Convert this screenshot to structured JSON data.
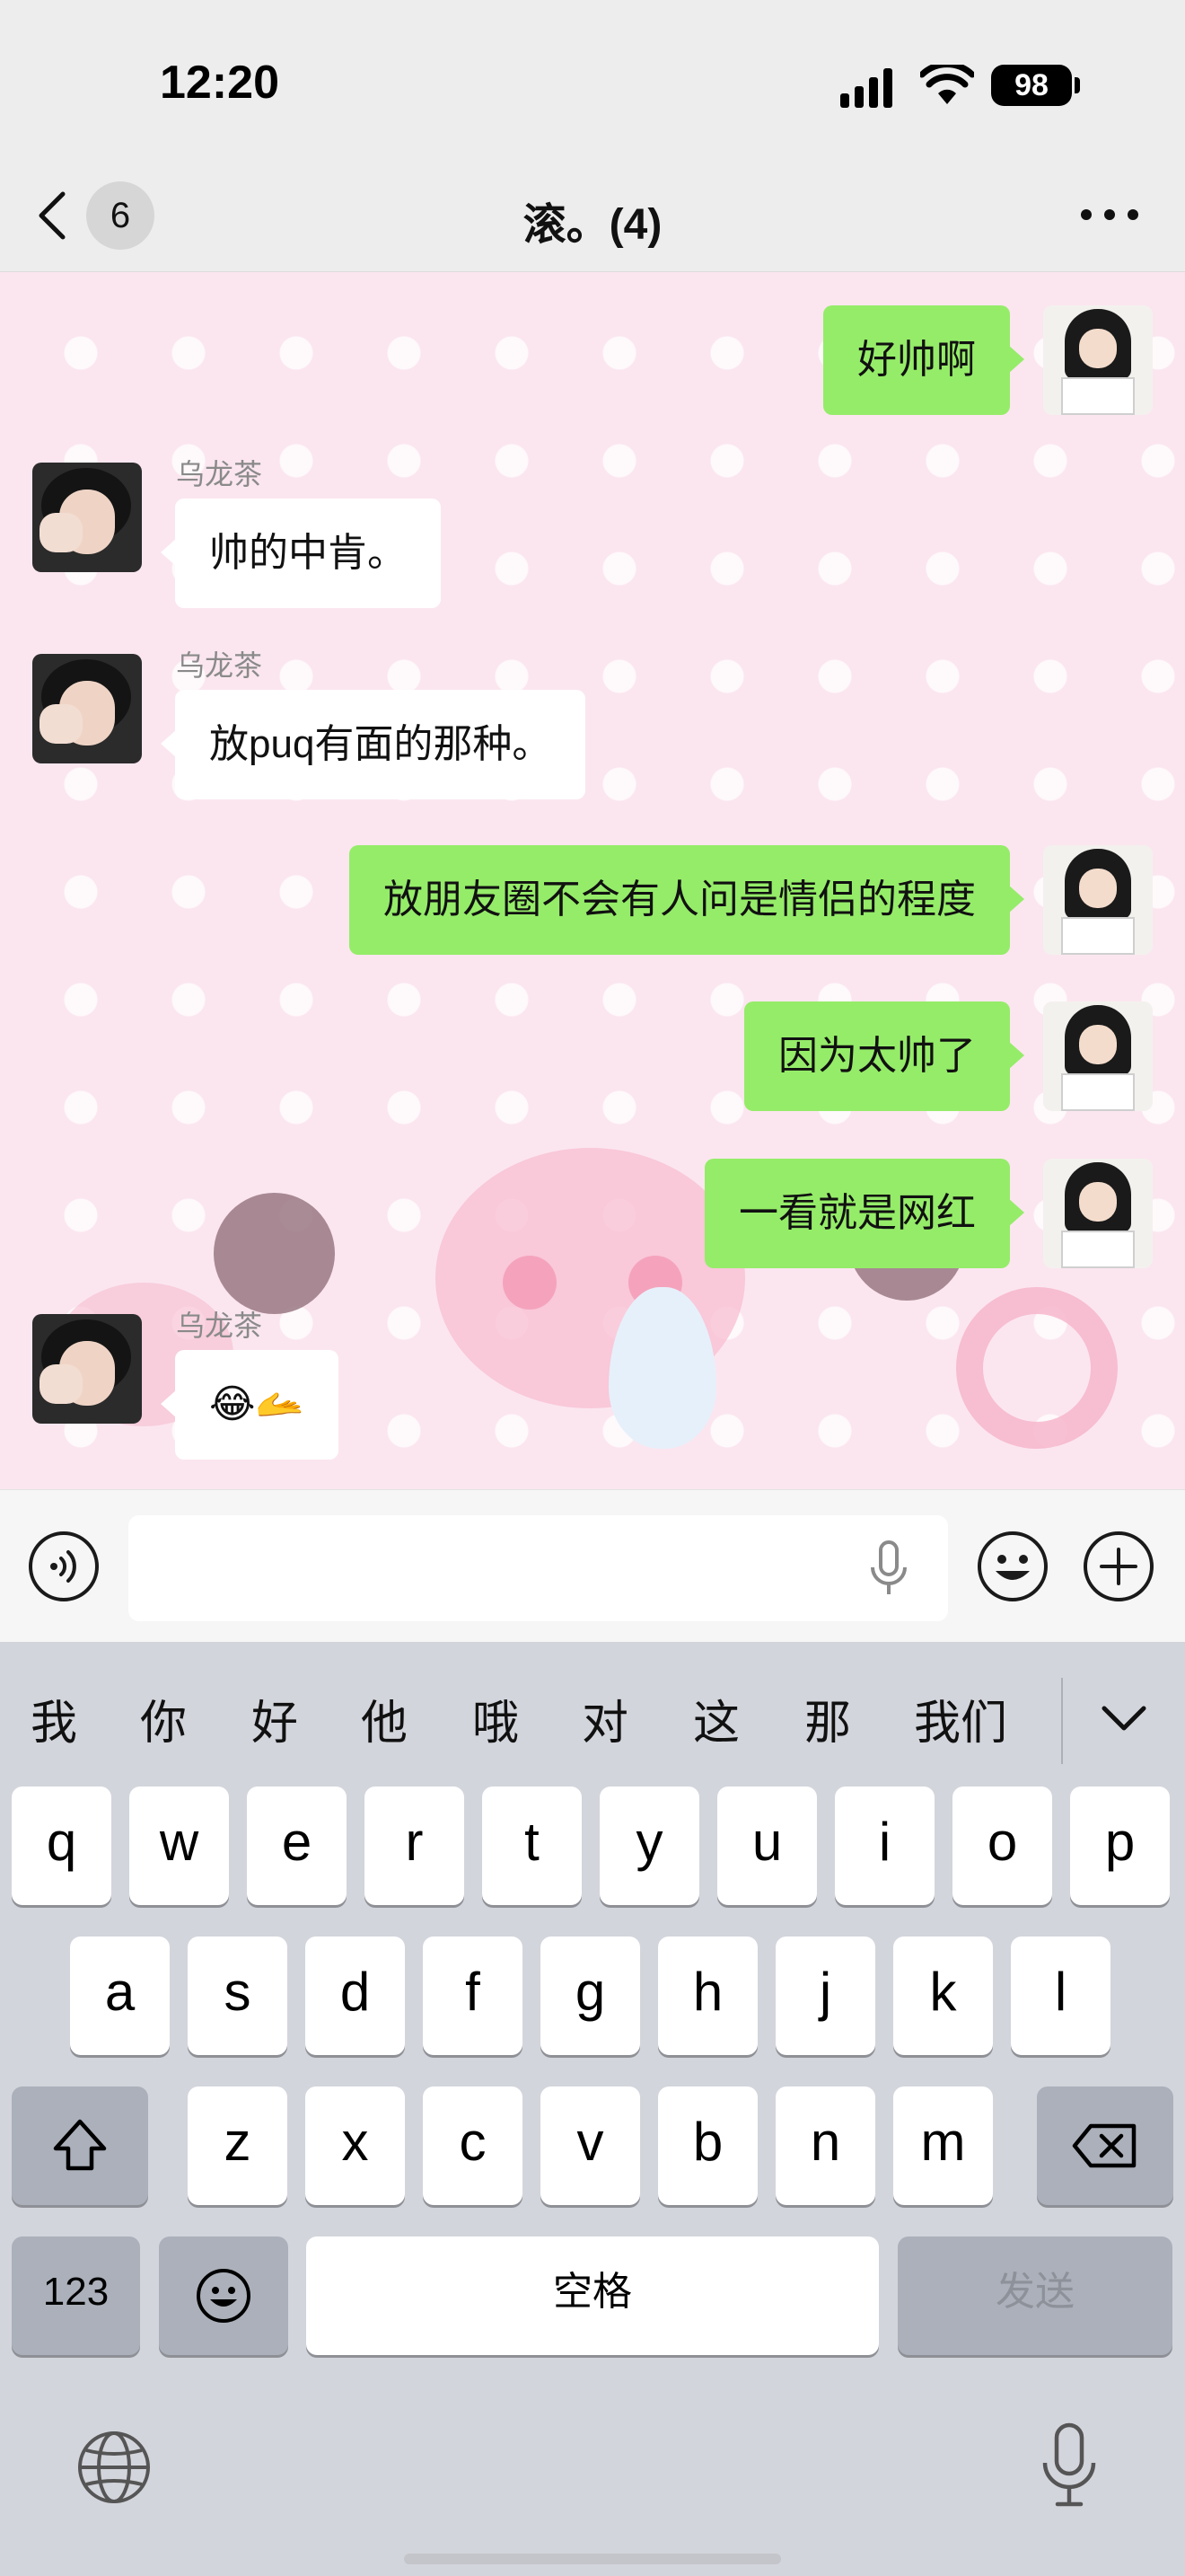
{
  "status_bar": {
    "time": "12:20",
    "battery": "98"
  },
  "nav": {
    "back_badge": "6",
    "title": "滚。(4)",
    "more_icon": "more-icon"
  },
  "messages": [
    {
      "side": "self",
      "text": "好帅啊"
    },
    {
      "side": "other",
      "sender": "乌龙茶",
      "text": "帅的中肯。"
    },
    {
      "side": "other",
      "sender": "乌龙茶",
      "text": "放puq有面的那种。"
    },
    {
      "side": "self",
      "text": "放朋友圈不会有人问是情侣的程度"
    },
    {
      "side": "self",
      "text": "因为太帅了"
    },
    {
      "side": "self",
      "text": "一看就是网红"
    },
    {
      "side": "other",
      "sender": "乌龙茶",
      "text": "😂🫴"
    }
  ],
  "input_bar": {
    "placeholder": ""
  },
  "keyboard": {
    "candidates": [
      "我",
      "你",
      "好",
      "他",
      "哦",
      "对",
      "这",
      "那",
      "我们"
    ],
    "row1": [
      "q",
      "w",
      "e",
      "r",
      "t",
      "y",
      "u",
      "i",
      "o",
      "p"
    ],
    "row2": [
      "a",
      "s",
      "d",
      "f",
      "g",
      "h",
      "j",
      "k",
      "l"
    ],
    "row3": [
      "z",
      "x",
      "c",
      "v",
      "b",
      "n",
      "m"
    ],
    "numbers_label": "123",
    "space_label": "空格",
    "send_label": "发送"
  }
}
